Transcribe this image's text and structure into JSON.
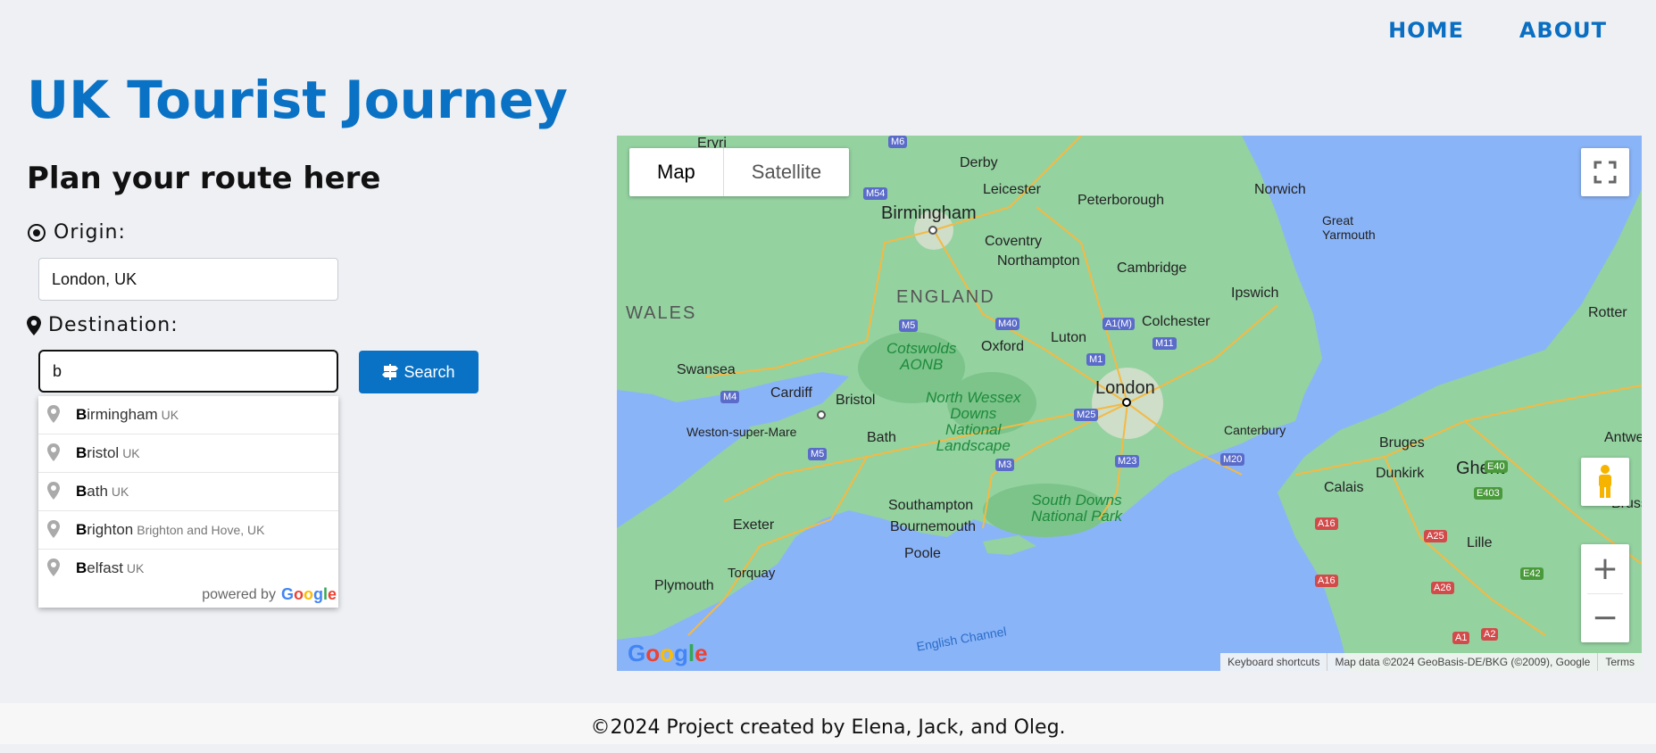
{
  "nav": {
    "home": "HOME",
    "about": "ABOUT"
  },
  "page": {
    "title": "UK Tourist Journey",
    "subtitle": "Plan your route here"
  },
  "form": {
    "origin_label": "Origin:",
    "origin_value": "London, UK",
    "destination_label": "Destination:",
    "destination_value": "b",
    "search_label": "Search"
  },
  "autocomplete": {
    "items": [
      {
        "match": "B",
        "rest": "irmingham",
        "secondary": "UK"
      },
      {
        "match": "B",
        "rest": "ristol",
        "secondary": "UK"
      },
      {
        "match": "B",
        "rest": "ath",
        "secondary": "UK"
      },
      {
        "match": "B",
        "rest": "righton",
        "secondary": "Brighton and Hove, UK"
      },
      {
        "match": "B",
        "rest": "elfast",
        "secondary": "UK"
      }
    ],
    "powered_by": "powered by",
    "google": "Google"
  },
  "map": {
    "map_type_map": "Map",
    "map_type_satellite": "Satellite",
    "attribution": {
      "shortcuts": "Keyboard shortcuts",
      "data": "Map data ©2024 GeoBasis-DE/BKG (©2009), Google",
      "terms": "Terms"
    },
    "logo": "Google",
    "labels": {
      "eryri": "Eryri",
      "derby": "Derby",
      "leicester": "Leicester",
      "peterborough": "Peterborough",
      "norwich": "Norwich",
      "great_yarmouth": "Great\nYarmouth",
      "birmingham": "Birmingham",
      "coventry": "Coventry",
      "northampton": "Northampton",
      "cambridge": "Cambridge",
      "wales": "WALES",
      "england": "ENGLAND",
      "ipswich": "Ipswich",
      "colchester": "Colchester",
      "cotswolds": "Cotswolds\nAONB",
      "oxford": "Oxford",
      "luton": "Luton",
      "swansea": "Swansea",
      "cardiff": "Cardiff",
      "bristol": "Bristol",
      "london": "London",
      "north_wessex": "North Wessex\nDowns\nNational\nLandscape",
      "weston": "Weston-super-Mare",
      "bath": "Bath",
      "canterbury": "Canterbury",
      "bruges": "Bruges",
      "antwerp": "Antwe",
      "rotterdam": "Rotter",
      "dunkirk": "Dunkirk",
      "ghent": "Ghent",
      "calais": "Calais",
      "brussels": "Brusse",
      "south_downs": "South Downs\nNational Park",
      "southampton": "Southampton",
      "bournemouth": "Bournemouth",
      "poole": "Poole",
      "exeter": "Exeter",
      "lille": "Lille",
      "torquay": "Torquay",
      "plymouth": "Plymouth",
      "english_channel": "English Channel"
    },
    "shields": [
      "M6",
      "M54",
      "M5",
      "M40",
      "A1(M)",
      "M11",
      "M4",
      "M1",
      "M25",
      "M5",
      "M3",
      "M23",
      "M20",
      "E40",
      "E403",
      "A16",
      "A25",
      "A16",
      "A26",
      "E42",
      "A1",
      "A2"
    ]
  },
  "footer": {
    "text": "©2024 Project created by Elena, Jack, and Oleg."
  }
}
